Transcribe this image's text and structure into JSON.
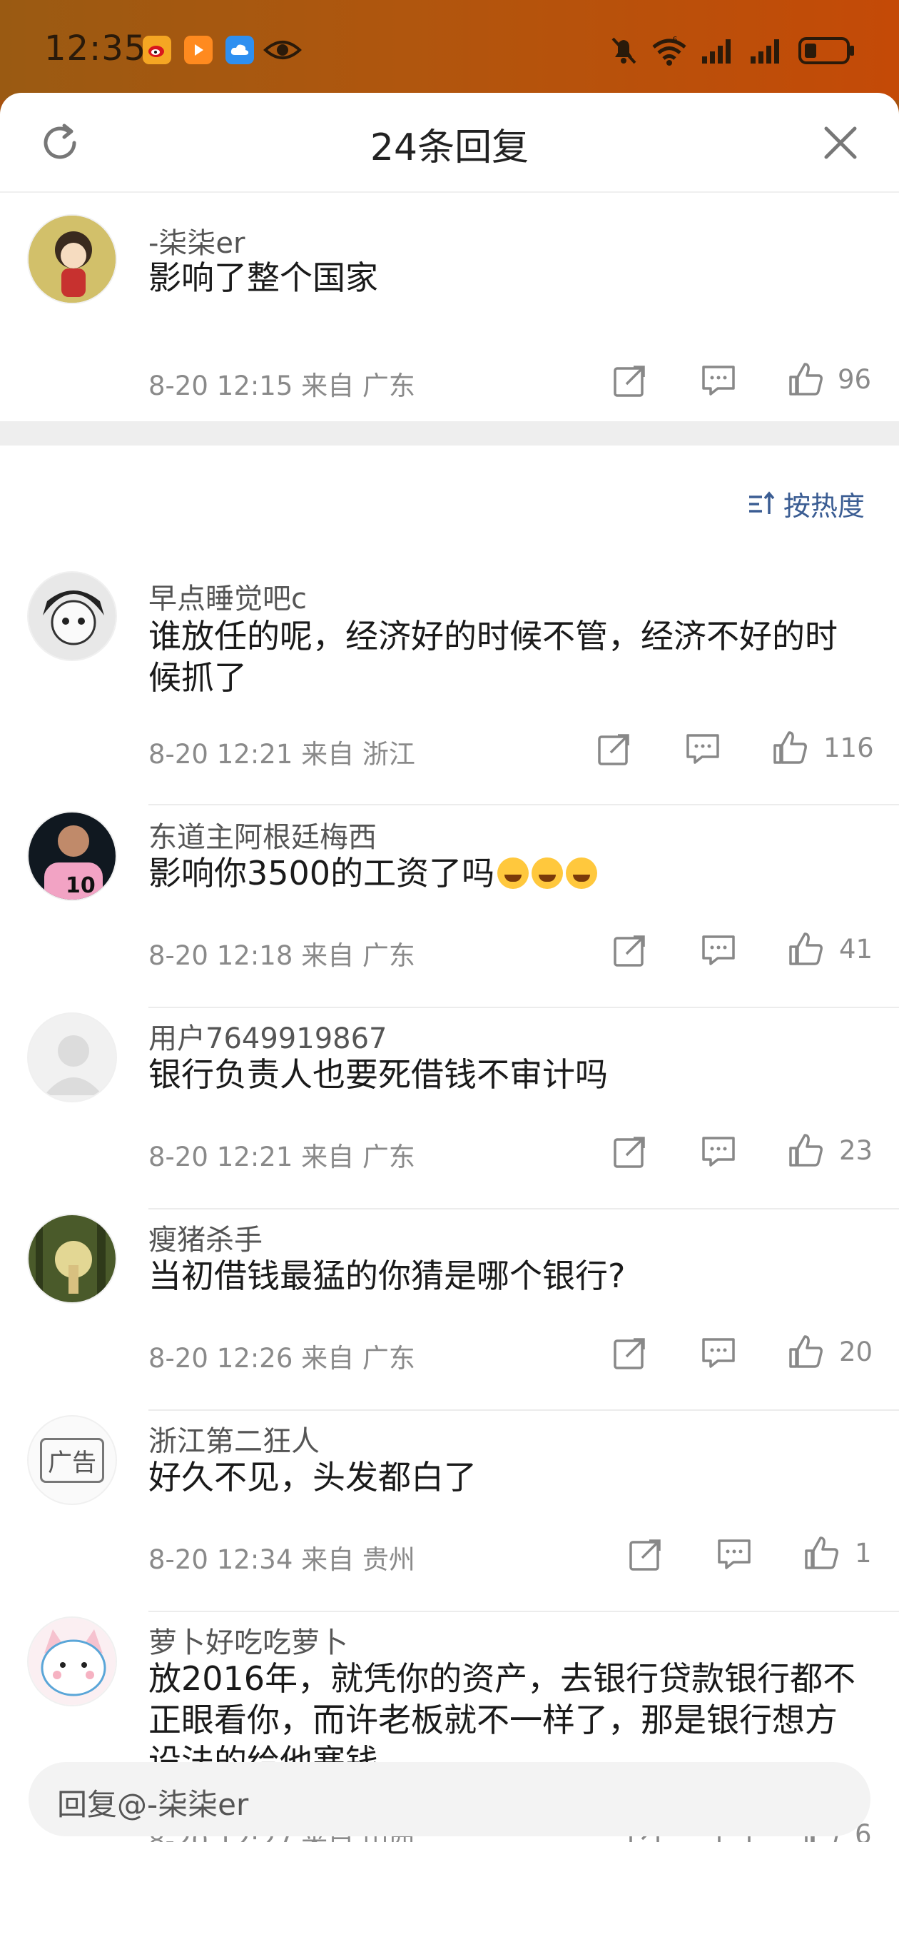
{
  "status_bar": {
    "time": "12:35",
    "apps": [
      {
        "icon": "weibo-icon",
        "color": "#f5a623"
      },
      {
        "icon": "video-app-icon",
        "color": "#ff8a1f"
      },
      {
        "icon": "cloud-app-icon",
        "color": "#2e8ff0"
      },
      {
        "icon": "eye-icon",
        "color": "#2a1a0a"
      }
    ],
    "signal": "6",
    "icons": [
      "mute-bell-icon",
      "wifi-icon",
      "signal-icon",
      "signal-icon",
      "battery-icon"
    ]
  },
  "sheet": {
    "title": "24条回复",
    "refresh_icon": "refresh-icon",
    "close_icon": "close-icon"
  },
  "root_comment": {
    "username": "-柒柒er",
    "content": "影响了整个国家",
    "meta": "8-20 12:15  来自 广东",
    "likes": "96"
  },
  "sort": {
    "label": "按热度",
    "icon": "sort-icon"
  },
  "replies": [
    {
      "username": "早点睡觉吧c",
      "content": "谁放任的呢，经济好的时候不管，经济不好的时候抓了",
      "meta": "8-20 12:21  来自 浙江",
      "likes": "116"
    },
    {
      "username": "东道主阿根廷梅西",
      "content": "影响你3500的工资了吗",
      "emoji_count": 3,
      "meta": "8-20 12:18  来自 广东",
      "likes": "41"
    },
    {
      "username": "用户7649919867",
      "content": "银行负责人也要死借钱不审计吗",
      "meta": "8-20 12:21  来自 广东",
      "likes": "23"
    },
    {
      "username": "瘦猪杀手",
      "content": "当初借钱最猛的你猜是哪个银行?",
      "meta": "8-20 12:26  来自 广东",
      "likes": "20"
    },
    {
      "username": "浙江第二狂人",
      "content": "好久不见，头发都白了",
      "meta": "8-20 12:34  来自 贵州",
      "likes": "1",
      "avatar_label": "广告"
    },
    {
      "username": "萝卜好吃吃萝卜",
      "content": "放2016年，就凭你的资产，去银行贷款银行都不正眼看你，而许老板就不一样了，那是银行想方设法的给他塞钱。",
      "meta": "8-20 12:27  来自 山西",
      "likes": "6"
    }
  ],
  "reply_bar": {
    "placeholder": "回复@-柒柒er"
  }
}
